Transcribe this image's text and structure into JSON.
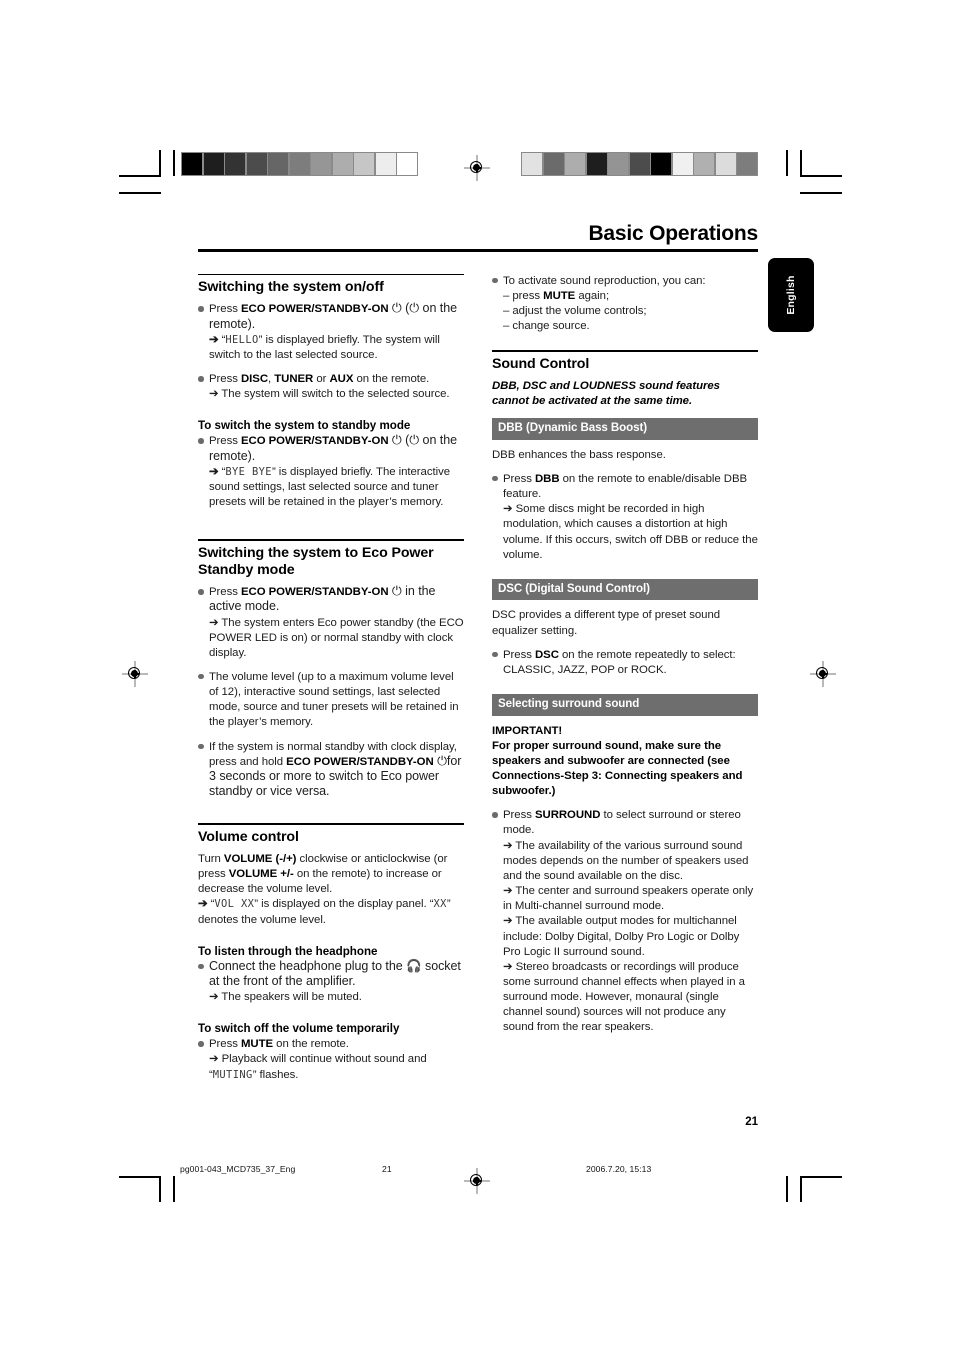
{
  "header": {
    "title": "Basic Operations"
  },
  "language_tab": {
    "label": "English"
  },
  "page_number": "21",
  "footer": {
    "file": "pg001-043_MCD735_37_Eng",
    "page": "21",
    "date": "2006.7.20, 15:13"
  },
  "calibration": {
    "left_strip": [
      "#000000",
      "#1e1e1e",
      "#333333",
      "#4c4c4c",
      "#666666",
      "#7d7d7d",
      "#969696",
      "#adadad",
      "#c6c6c6",
      "#ededed",
      "#ffffff"
    ],
    "right_strip": [
      "#e2e2e2",
      "#6b6b6b",
      "#adadad",
      "#1e1e1e",
      "#949494",
      "#4c4c4c",
      "#000000",
      "#f0f0f0",
      "#b0b0b0",
      "#dcdcdc",
      "#7d7d7d"
    ]
  },
  "left_column": {
    "section1": {
      "heading": "Switching the system on/off",
      "b1_pre": "Press ",
      "b1_bold": "ECO POWER/STANDBY-ON",
      "b1_post": " ⏻ (⏻ on the remote).",
      "b1_arrow": "➔ “HELLO” is displayed briefly. The system will switch to the last selected source.",
      "b1_lcd": "HELLO",
      "b2_pre": "Press ",
      "b2_bold1": "DISC",
      "b2_mid1": ", ",
      "b2_bold2": "TUNER",
      "b2_mid2": " or ",
      "b2_bold3": "AUX",
      "b2_post": " on the remote.",
      "b2_arrow": "➔ The system will switch to the selected source.",
      "sub1": "To switch the system to standby mode",
      "b3_pre": "Press ",
      "b3_bold": "ECO POWER/STANDBY-ON",
      "b3_post": " ⏻ (⏻ on the remote).",
      "b3_lcd": "BYE BYE",
      "b3_arrow": "➔ “BYE BYE” is displayed briefly. The interactive sound settings, last selected source and tuner presets will be retained in the player’s memory."
    },
    "section2": {
      "heading": "Switching the system to Eco Power Standby mode",
      "b1_pre": "Press ",
      "b1_bold": "ECO POWER/STANDBY-ON",
      "b1_post": " ⏻ in the active mode.",
      "b1_arrow": "➔ The system enters Eco power standby (the ECO POWER LED is on) or normal standby with clock display.",
      "b2": "The volume level (up to a maximum volume level of 12), interactive sound settings, last selected mode, source and tuner presets will be retained in the player’s memory.",
      "b3_pre": "If the system is normal standby with clock display, press and hold ",
      "b3_bold": "ECO POWER/STANDBY-ON",
      "b3_post": " ⏻for 3 seconds or more to switch to Eco power standby or vice versa."
    },
    "section3": {
      "heading": "Volume control",
      "p1_pre": "Turn ",
      "p1_bold1": "VOLUME (-/+)",
      "p1_mid": " clockwise or anticlockwise (or press ",
      "p1_bold2": "VOLUME +/-",
      "p1_post": " on the remote) to increase or decrease the volume level.",
      "p2_lcd1": "VOL XX",
      "p2_text1": " is displayed on the display panel. ",
      "p2_lcd2": "XX",
      "p2_text2": " denotes the volume level.",
      "sub1": "To listen through the headphone",
      "b1": "Connect the headphone plug to the 🎧 socket at the front of the amplifier.",
      "b1_arrow": "➔ The speakers will be muted.",
      "sub2": "To switch off the volume temporarily",
      "b2_pre": "Press ",
      "b2_bold": "MUTE",
      "b2_post": " on the remote.",
      "b2_arrow": "➔ Playback will continue without sound and",
      "b2_lcd": "MUTING",
      "b2_arrow_end": " flashes."
    }
  },
  "right_column": {
    "intro": {
      "b1": "To activate sound reproduction, you can:",
      "sub_items": [
        "– press MUTE again;",
        "– adjust the volume  controls;",
        "– change source."
      ],
      "sub1_pre": "– press ",
      "sub1_bold": "MUTE",
      "sub1_post": " again;",
      "sub2": "– adjust the volume  controls;",
      "sub3": "– change source."
    },
    "sound_control": {
      "heading": "Sound Control",
      "note": "DBB, DSC and LOUDNESS sound features cannot be activated at the same time."
    },
    "dbb": {
      "bar": "DBB (Dynamic Bass Boost)",
      "p1": "DBB enhances the bass response.",
      "b1_pre": "Press ",
      "b1_bold": "DBB",
      "b1_post": " on the remote to enable/disable DBB feature.",
      "b1_arrow": "➔ Some discs might be recorded in high modulation, which causes a distortion at high volume. If this occurs, switch off DBB or reduce the volume."
    },
    "dsc": {
      "bar": "DSC (Digital Sound Control)",
      "p1": "DSC provides a different type of preset sound equalizer setting.",
      "b1_pre": "Press ",
      "b1_bold": "DSC",
      "b1_post": " on the remote repeatedly to select: CLASSIC, JAZZ, POP or ROCK."
    },
    "surround": {
      "bar": "Selecting surround sound",
      "important_title": "IMPORTANT!",
      "important_body": "For proper surround sound, make sure the speakers and subwoofer are connected (see Connections-Step 3: Connecting speakers and subwoofer.)",
      "b1_pre": "Press ",
      "b1_bold": "SURROUND",
      "b1_post": " to select surround or stereo mode.",
      "arrow1": "➔ The availability of the various surround sound modes depends on the number of speakers used and the sound available on the disc.",
      "arrow2": "➔ The center and surround speakers operate only in Multi-channel surround mode.",
      "arrow3": "➔ The available output modes for multichannel include: Dolby Digital, Dolby Pro Logic or Dolby Pro Logic II surround sound.",
      "arrow4": "➔ Stereo broadcasts or recordings will produce some surround channel effects when played in a surround mode. However, monaural (single channel sound) sources will not produce any sound from the rear speakers."
    }
  }
}
